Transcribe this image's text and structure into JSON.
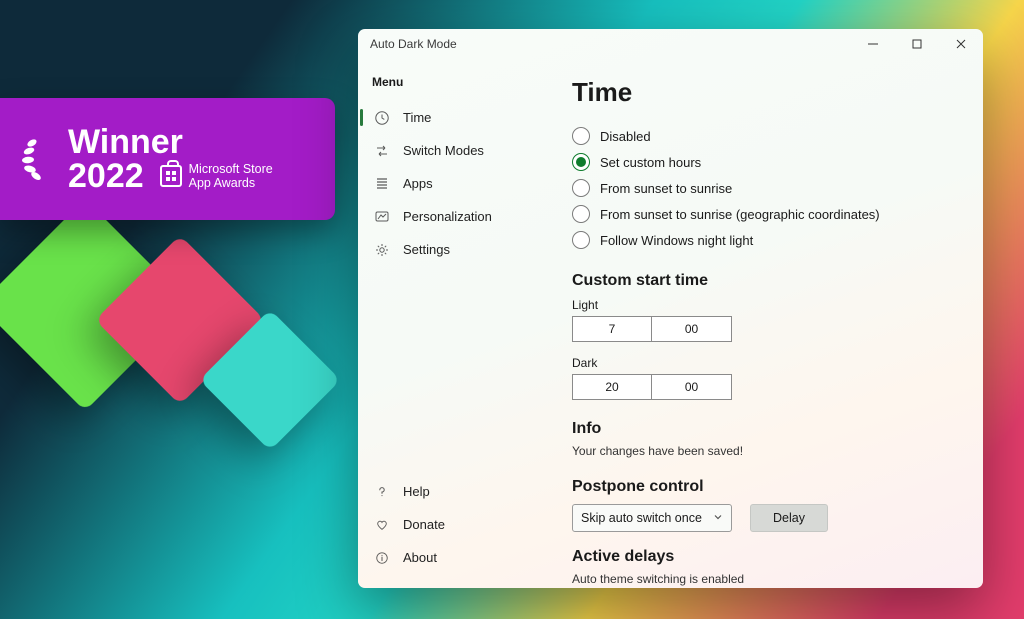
{
  "banner": {
    "title": "Winner",
    "year": "2022",
    "award_line1": "Microsoft Store",
    "award_line2": "App Awards"
  },
  "window": {
    "title": "Auto Dark Mode"
  },
  "sidebar": {
    "menu_label": "Menu",
    "items": [
      {
        "label": "Time"
      },
      {
        "label": "Switch Modes"
      },
      {
        "label": "Apps"
      },
      {
        "label": "Personalization"
      },
      {
        "label": "Settings"
      }
    ],
    "footer": [
      {
        "label": "Help"
      },
      {
        "label": "Donate"
      },
      {
        "label": "About"
      }
    ]
  },
  "page": {
    "title": "Time",
    "radios": {
      "disabled": "Disabled",
      "custom": "Set custom hours",
      "sunset": "From sunset to sunrise",
      "sunset_geo": "From sunset to sunrise (geographic coordinates)",
      "night_light": "Follow Windows night light"
    },
    "custom_start": {
      "heading": "Custom start time",
      "light_label": "Light",
      "light_h": "7",
      "light_m": "00",
      "dark_label": "Dark",
      "dark_h": "20",
      "dark_m": "00"
    },
    "info": {
      "heading": "Info",
      "text": "Your changes have been saved!"
    },
    "postpone": {
      "heading": "Postpone control",
      "dropdown": "Skip auto switch once",
      "button": "Delay"
    },
    "active_delays": {
      "heading": "Active delays",
      "text": "Auto theme switching is enabled"
    }
  }
}
